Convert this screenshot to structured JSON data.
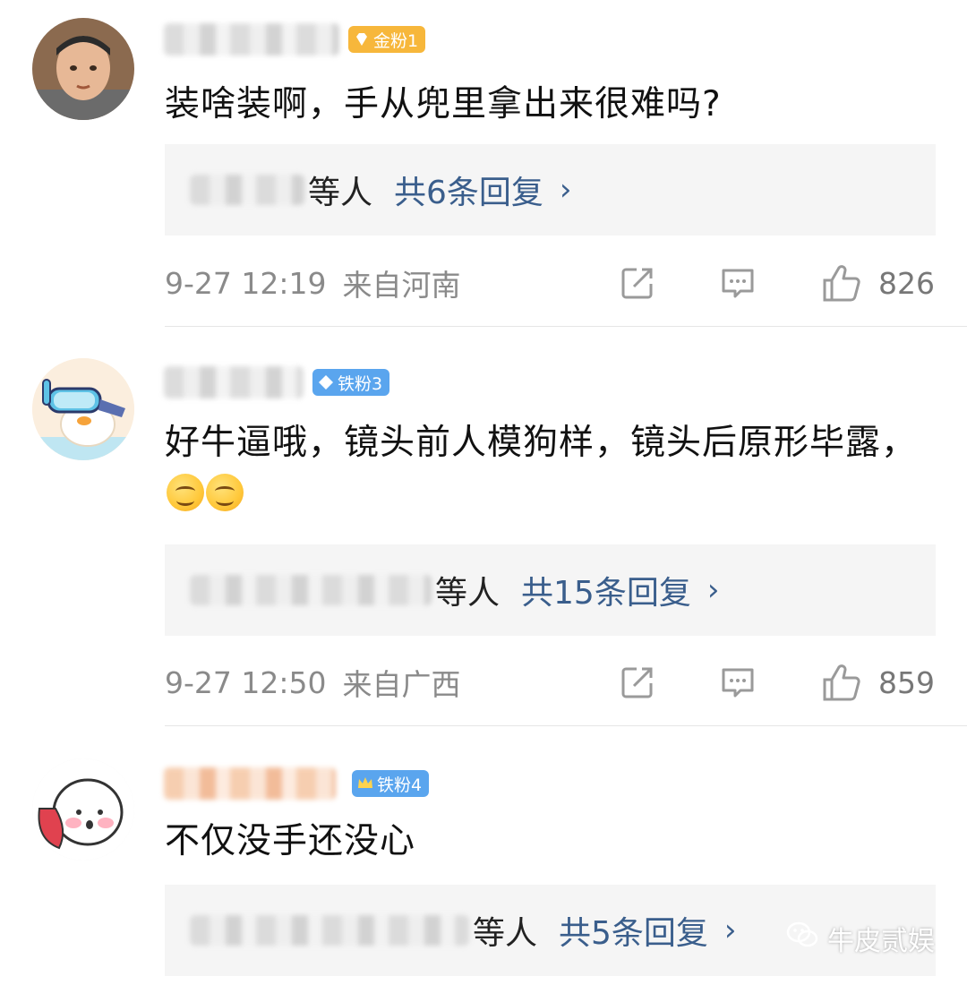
{
  "comments": [
    {
      "badge": "金粉1",
      "badge_color": "#f7b73b",
      "text": "装啥装啊，手从兜里拿出来很难吗?",
      "reply_others": "等人",
      "reply_count": "共6条回复",
      "time": "9-27 12:19",
      "location": "来自河南",
      "likes": "826"
    },
    {
      "badge": "铁粉3",
      "badge_color": "#5aa5ee",
      "text": "好牛逼哦，镜头前人模狗样，镜头后原形毕露，",
      "emojis": [
        "smile-emoji",
        "smile-emoji"
      ],
      "reply_others": "等人",
      "reply_count": "共15条回复",
      "time": "9-27 12:50",
      "location": "来自广西",
      "likes": "859"
    },
    {
      "badge": "铁粉4",
      "badge_color": "#5aa5ee",
      "text": "不仅没手还没心",
      "reply_others": "等人",
      "reply_count": "共5条回复"
    }
  ],
  "icons": {
    "share": "share-icon",
    "comment": "comment-icon",
    "like": "thumbs-up-icon",
    "chevron": "chevron-right-icon"
  },
  "watermark": {
    "text": "牛皮贰娱"
  }
}
